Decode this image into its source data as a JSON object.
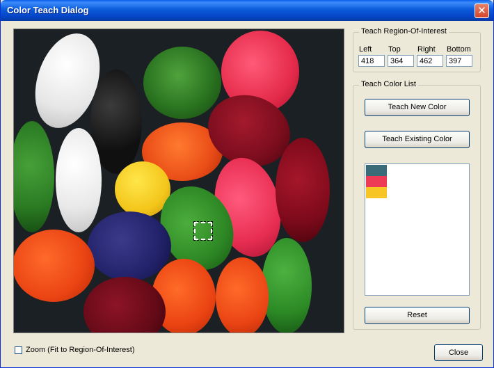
{
  "window": {
    "title": "Color Teach Dialog",
    "close_glyph": "✕"
  },
  "roi": {
    "group_label": "Teach Region-Of-Interest",
    "left_label": "Left",
    "top_label": "Top",
    "right_label": "Right",
    "bottom_label": "Bottom",
    "left": "418",
    "top": "364",
    "right": "462",
    "bottom": "397"
  },
  "color_list": {
    "group_label": "Teach Color List",
    "teach_new": "Teach New Color",
    "teach_existing": "Teach Existing Color",
    "reset": "Reset",
    "swatches": [
      "#3a6b78",
      "#ef3a55",
      "#f7c624"
    ]
  },
  "zoom_label": "Zoom (Fit to Region-Of-Interest)",
  "zoom_checked": false,
  "close_button": "Close"
}
